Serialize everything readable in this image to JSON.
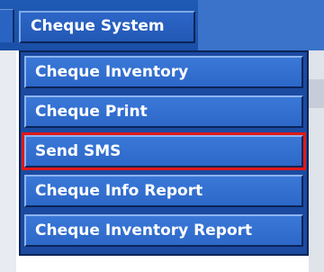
{
  "menu": {
    "top_label": "Cheque System",
    "items": [
      {
        "label": "Cheque Inventory"
      },
      {
        "label": "Cheque Print"
      },
      {
        "label": "Send SMS",
        "highlighted": true
      },
      {
        "label": "Cheque Info Report"
      },
      {
        "label": "Cheque Inventory Report"
      }
    ]
  },
  "colors": {
    "menu_blue": "#2d68c8",
    "menu_text": "#ffffff",
    "highlight_border": "#e01818"
  }
}
